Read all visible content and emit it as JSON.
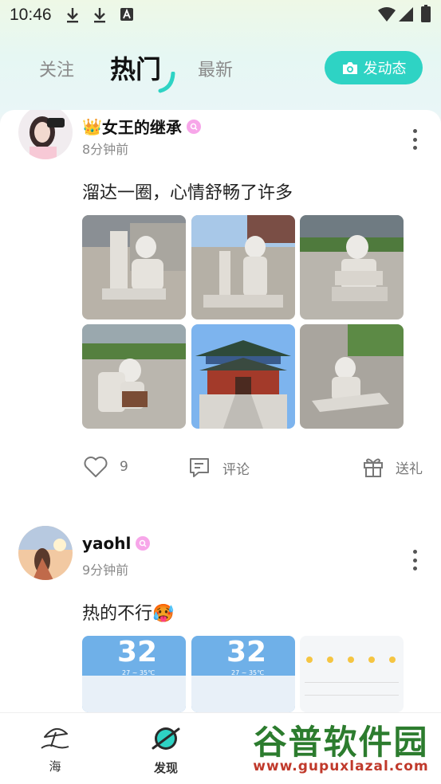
{
  "status": {
    "time": "10:46"
  },
  "header": {
    "tabs": [
      {
        "label": "关注",
        "active": false
      },
      {
        "label": "热门",
        "active": true
      },
      {
        "label": "最新",
        "active": false
      }
    ],
    "post_button": "发动态",
    "accent_color": "#2ed3c4"
  },
  "posts": [
    {
      "username": "女王的继承",
      "crown": "👑",
      "time": "8分钟前",
      "text": "溜达一圈，心情舒畅了许多",
      "likes": "9",
      "comment_label": "评论",
      "gift_label": "送礼"
    },
    {
      "username": "yaohl",
      "time": "9分钟前",
      "text": "热的不行🥵"
    }
  ],
  "weather": {
    "temp": "32",
    "range": "27 ~ 35℃"
  },
  "bottom_nav": [
    {
      "label": "海",
      "icon": "beach-umbrella-icon"
    },
    {
      "label": "发现",
      "icon": "planet-icon",
      "active": true
    }
  ],
  "watermark": {
    "main": "谷普软件园",
    "url": "www.gupuxlazal.com"
  }
}
